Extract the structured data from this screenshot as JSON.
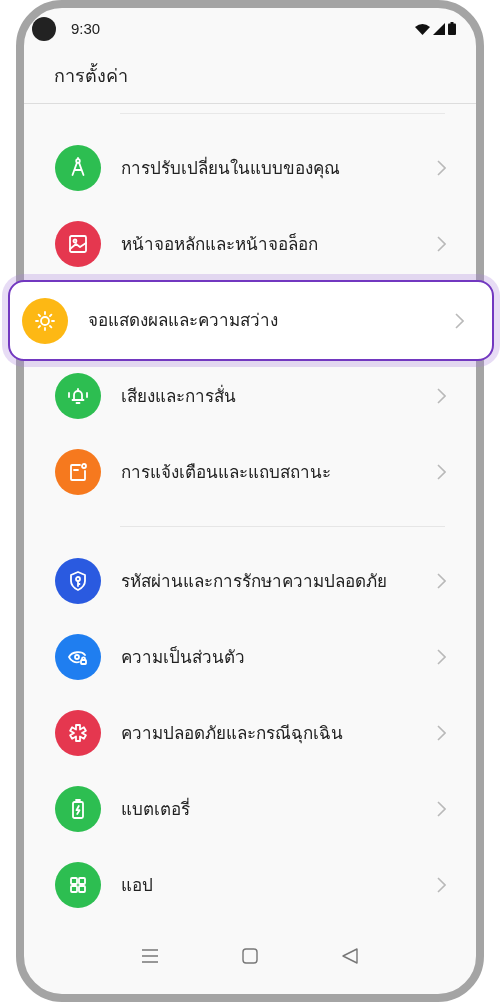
{
  "status_bar": {
    "time": "9:30"
  },
  "header": {
    "title": "การตั้งค่า"
  },
  "groups": [
    {
      "items": [
        {
          "label": "การปรับเปลี่ยนในแบบของคุณ",
          "color": "#2dbe51",
          "selected": false
        },
        {
          "label": "หน้าจอหลักและหน้าจอล็อก",
          "color": "#e5374f",
          "selected": false
        },
        {
          "label": "จอแสดงผลและความสว่าง",
          "color": "#fdb814",
          "selected": true
        },
        {
          "label": "เสียงและการสั่น",
          "color": "#2dbe51",
          "selected": false
        },
        {
          "label": "การแจ้งเตือนและแถบสถานะ",
          "color": "#f6791e",
          "selected": false
        }
      ]
    },
    {
      "items": [
        {
          "label": "รหัสผ่านและการรักษาความปลอดภัย",
          "color": "#2a5ae0",
          "selected": false
        },
        {
          "label": "ความเป็นส่วนตัว",
          "color": "#1f7ef0",
          "selected": false
        },
        {
          "label": "ความปลอดภัยและกรณีฉุกเฉิน",
          "color": "#e5374f",
          "selected": false
        },
        {
          "label": "แบตเตอรี่",
          "color": "#2dbe51",
          "selected": false
        },
        {
          "label": "แอป",
          "color": "#2dbe51",
          "selected": false
        }
      ]
    }
  ]
}
